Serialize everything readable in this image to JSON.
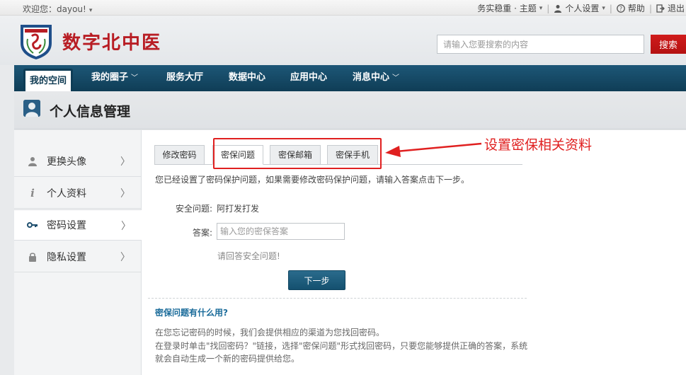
{
  "topbar": {
    "welcome": "欢迎您：dayou!",
    "theme": "务实稳重 · 主题",
    "settings": "个人设置",
    "help": "帮助",
    "logout": "退出"
  },
  "header": {
    "site_name": "数字北中医",
    "search_placeholder": "请输入您要搜索的内容",
    "search_button": "搜索"
  },
  "nav": {
    "items": [
      {
        "label": "我的空间",
        "active": true
      },
      {
        "label": "我的圈子",
        "has_dropdown": true
      },
      {
        "label": "服务大厅"
      },
      {
        "label": "数据中心"
      },
      {
        "label": "应用中心"
      },
      {
        "label": "消息中心",
        "has_dropdown": true
      }
    ]
  },
  "page": {
    "title": "个人信息管理"
  },
  "sidebar": {
    "items": [
      {
        "label": "更换头像",
        "icon": "user-icon"
      },
      {
        "label": "个人资料",
        "icon": "info-icon"
      },
      {
        "label": "密码设置",
        "icon": "key-icon",
        "active": true
      },
      {
        "label": "隐私设置",
        "icon": "lock-icon"
      }
    ]
  },
  "tabs": [
    {
      "label": "修改密码"
    },
    {
      "label": "密保问题",
      "active": true
    },
    {
      "label": "密保邮箱"
    },
    {
      "label": "密保手机"
    }
  ],
  "annotation": "设置密保相关资料",
  "form": {
    "info": "您已经设置了密码保护问题，如果需要修改密码保护问题，请输入答案点击下一步。",
    "question_label": "安全问题:",
    "question_value": "阿打发打发",
    "answer_label": "答案:",
    "answer_placeholder": "输入您的密保答案",
    "hint": "请回答安全问题!",
    "next_button": "下一步"
  },
  "faq": {
    "title": "密保问题有什么用?",
    "line1": "在您忘记密码的时候，我们会提供相应的渠道为您找回密码。",
    "line2": "在登录时单击\"找回密码？\"链接，选择\"密保问题\"形式找回密码，只要您能够提供正确的答案，系统",
    "line3": "就会自动生成一个新的密码提供给您。"
  },
  "colors": {
    "nav_bg": "#0f3d56",
    "brand_red": "#b81d24",
    "annotation_red": "#e02020",
    "link_blue": "#1a6b9a"
  }
}
